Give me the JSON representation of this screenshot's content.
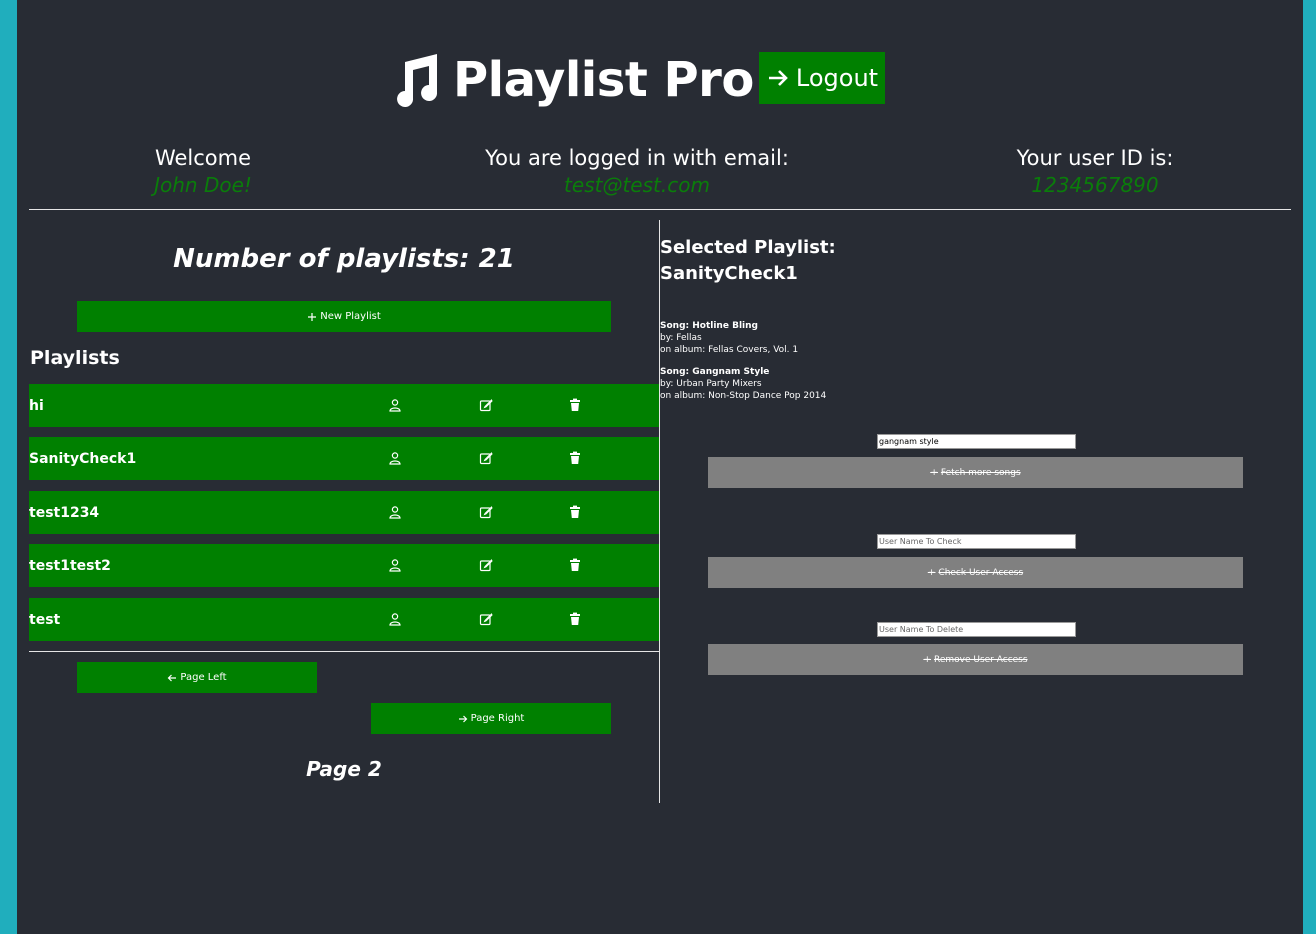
{
  "header": {
    "app_title": "Playlist Pro",
    "logout_label": "Logout"
  },
  "user_info": {
    "welcome_label": "Welcome",
    "name": "John Doe!",
    "email_label": "You are logged in with email:",
    "email": "test@test.com",
    "id_label": "Your user ID is:",
    "user_id": "1234567890"
  },
  "left": {
    "count_text": "Number of playlists: 21",
    "new_playlist_label": "New Playlist",
    "playlists_heading": "Playlists",
    "playlists": [
      {
        "name": "hi"
      },
      {
        "name": "SanityCheck1"
      },
      {
        "name": "test1234"
      },
      {
        "name": "test1test2"
      },
      {
        "name": "test"
      }
    ],
    "page_left_label": "Page Left",
    "page_right_label": "Page Right",
    "page_text": "Page 2"
  },
  "right": {
    "selected_label": "Selected Playlist:",
    "selected_name": "SanityCheck1",
    "songs": [
      {
        "title": "Song: Hotline Bling",
        "by": "by: Fellas",
        "album": "on album: Fellas Covers, Vol. 1"
      },
      {
        "title": "Song: Gangnam Style",
        "by": "by: Urban Party Mixers",
        "album": "on album: Non-Stop Dance Pop 2014"
      }
    ],
    "search_value": "gangnam style",
    "fetch_label": "Fetch more songs",
    "check_placeholder": "User Name To Check",
    "check_label": "Check User Access",
    "delete_placeholder": "User Name To Delete",
    "remove_label": "Remove User Access"
  },
  "colors": {
    "accent_green": "#008000",
    "disabled_gray": "#808080",
    "background": "#282c34",
    "outer": "#20aebd"
  },
  "icons": [
    "music-note-icon",
    "arrow-right-icon",
    "plus-icon",
    "user-icon",
    "edit-icon",
    "trash-icon",
    "arrow-left-icon"
  ]
}
